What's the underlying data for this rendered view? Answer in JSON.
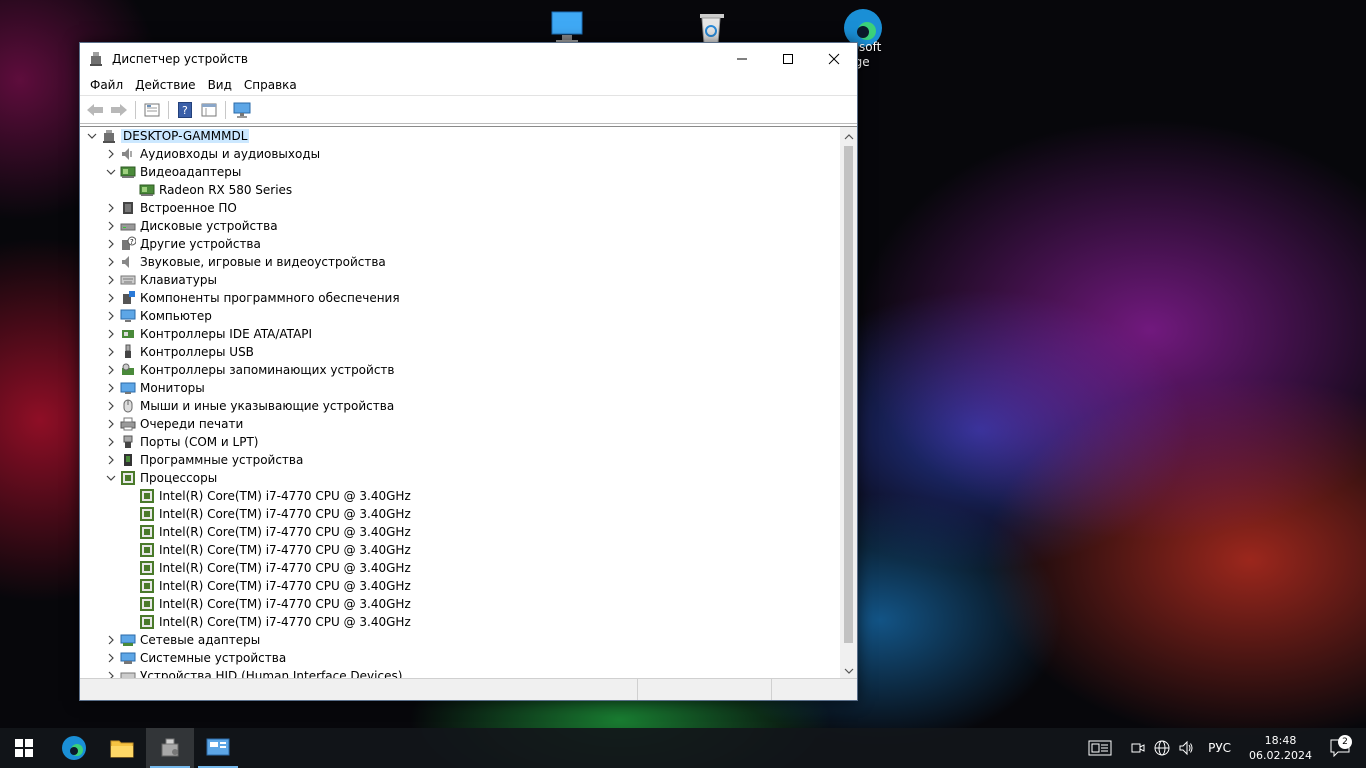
{
  "desktop": {
    "icons": [
      {
        "name": "this-pc",
        "label": ""
      },
      {
        "name": "recycle-bin",
        "label": ""
      },
      {
        "name": "edge",
        "label": "rosoft\ndge"
      }
    ]
  },
  "window": {
    "title": "Диспетчер устройств",
    "menu": [
      "Файл",
      "Действие",
      "Вид",
      "Справка"
    ],
    "toolbar_icons": [
      "back-icon",
      "forward-icon",
      "properties-icon",
      "help-icon",
      "view-icon",
      "monitor-icon"
    ]
  },
  "tree": {
    "root": "DESKTOP-GAMMMDL",
    "items": [
      {
        "label": "Аудиовходы и аудиовыходы",
        "icon": "audio-icon",
        "expanded": false,
        "level": 1
      },
      {
        "label": "Видеоадаптеры",
        "icon": "display-adapter-icon",
        "expanded": true,
        "level": 1
      },
      {
        "label": "Radeon RX 580 Series",
        "icon": "display-adapter-icon",
        "level": 2
      },
      {
        "label": "Встроенное ПО",
        "icon": "firmware-icon",
        "expanded": false,
        "level": 1
      },
      {
        "label": "Дисковые устройства",
        "icon": "disk-icon",
        "expanded": false,
        "level": 1
      },
      {
        "label": "Другие устройства",
        "icon": "unknown-device-icon",
        "expanded": false,
        "level": 1
      },
      {
        "label": "Звуковые, игровые и видеоустройства",
        "icon": "sound-icon",
        "expanded": false,
        "level": 1
      },
      {
        "label": "Клавиатуры",
        "icon": "keyboard-icon",
        "expanded": false,
        "level": 1
      },
      {
        "label": "Компоненты программного обеспечения",
        "icon": "software-component-icon",
        "expanded": false,
        "level": 1
      },
      {
        "label": "Компьютер",
        "icon": "computer-icon",
        "expanded": false,
        "level": 1
      },
      {
        "label": "Контроллеры IDE ATA/ATAPI",
        "icon": "ide-icon",
        "expanded": false,
        "level": 1
      },
      {
        "label": "Контроллеры USB",
        "icon": "usb-icon",
        "expanded": false,
        "level": 1
      },
      {
        "label": "Контроллеры запоминающих устройств",
        "icon": "storage-controller-icon",
        "expanded": false,
        "level": 1
      },
      {
        "label": "Мониторы",
        "icon": "monitor-icon",
        "expanded": false,
        "level": 1
      },
      {
        "label": "Мыши и иные указывающие устройства",
        "icon": "mouse-icon",
        "expanded": false,
        "level": 1
      },
      {
        "label": "Очереди печати",
        "icon": "print-queue-icon",
        "expanded": false,
        "level": 1
      },
      {
        "label": "Порты (COM и LPT)",
        "icon": "port-icon",
        "expanded": false,
        "level": 1
      },
      {
        "label": "Программные устройства",
        "icon": "software-device-icon",
        "expanded": false,
        "level": 1
      },
      {
        "label": "Процессоры",
        "icon": "processor-icon",
        "expanded": true,
        "level": 1
      },
      {
        "label": "Intel(R) Core(TM) i7-4770 CPU @ 3.40GHz",
        "icon": "processor-icon",
        "level": 2
      },
      {
        "label": "Intel(R) Core(TM) i7-4770 CPU @ 3.40GHz",
        "icon": "processor-icon",
        "level": 2
      },
      {
        "label": "Intel(R) Core(TM) i7-4770 CPU @ 3.40GHz",
        "icon": "processor-icon",
        "level": 2
      },
      {
        "label": "Intel(R) Core(TM) i7-4770 CPU @ 3.40GHz",
        "icon": "processor-icon",
        "level": 2
      },
      {
        "label": "Intel(R) Core(TM) i7-4770 CPU @ 3.40GHz",
        "icon": "processor-icon",
        "level": 2
      },
      {
        "label": "Intel(R) Core(TM) i7-4770 CPU @ 3.40GHz",
        "icon": "processor-icon",
        "level": 2
      },
      {
        "label": "Intel(R) Core(TM) i7-4770 CPU @ 3.40GHz",
        "icon": "processor-icon",
        "level": 2
      },
      {
        "label": "Intel(R) Core(TM) i7-4770 CPU @ 3.40GHz",
        "icon": "processor-icon",
        "level": 2
      },
      {
        "label": "Сетевые адаптеры",
        "icon": "network-adapter-icon",
        "expanded": false,
        "level": 1
      },
      {
        "label": "Системные устройства",
        "icon": "system-device-icon",
        "expanded": false,
        "level": 1
      },
      {
        "label": "Устройства HID (Human Interface Devices)",
        "icon": "hid-icon",
        "expanded": false,
        "level": 1
      }
    ]
  },
  "taskbar": {
    "apps": [
      "start-icon",
      "edge-icon",
      "file-explorer-icon",
      "device-manager-icon",
      "control-panel-icon"
    ],
    "language": "РУС",
    "time": "18:48",
    "date": "06.02.2024",
    "notifications": "2"
  }
}
